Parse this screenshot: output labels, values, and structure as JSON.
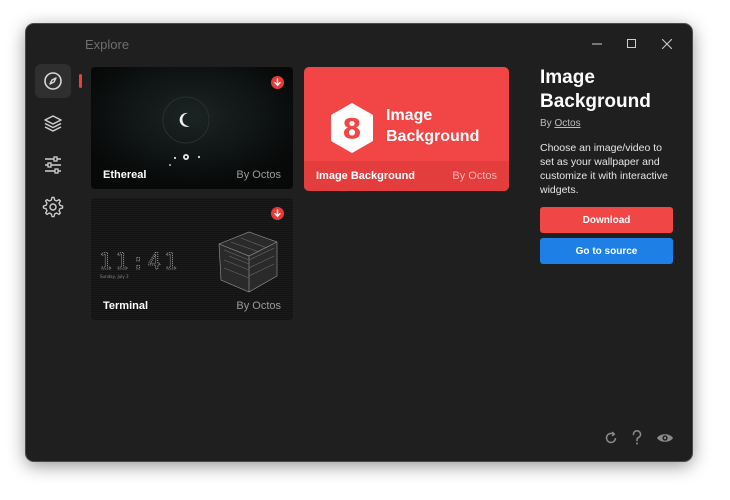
{
  "window": {
    "title": "Explore"
  },
  "sidebar": {
    "items": [
      {
        "icon": "compass-icon",
        "active": true
      },
      {
        "icon": "layers-icon",
        "active": false
      },
      {
        "icon": "sliders-icon",
        "active": false
      },
      {
        "icon": "gear-icon",
        "active": false
      }
    ],
    "logo_icon": "hexagon-icon"
  },
  "cards": [
    {
      "name": "Ethereal",
      "author": "By Octos",
      "download_badge": true
    },
    {
      "name": "Image Background",
      "author": "By Octos",
      "selected": true,
      "logo_text_1": "Image",
      "logo_text_2": "Background"
    },
    {
      "name": "Terminal",
      "author": "By Octos",
      "download_badge": true,
      "clock": "11:41",
      "date": "Sunday, July 3"
    }
  ],
  "detail": {
    "title": "Image Background",
    "by_prefix": "By",
    "by_author": "Octos",
    "description": "Choose an image/video to set as your wallpaper and customize it with interactive widgets.",
    "download_label": "Download",
    "source_label": "Go to source"
  },
  "colors": {
    "accent_red": "#f04646",
    "accent_blue": "#1e7fe6",
    "background": "#1f1f1f"
  },
  "footer_icons": [
    "refresh-icon",
    "help-icon",
    "eye-icon"
  ]
}
